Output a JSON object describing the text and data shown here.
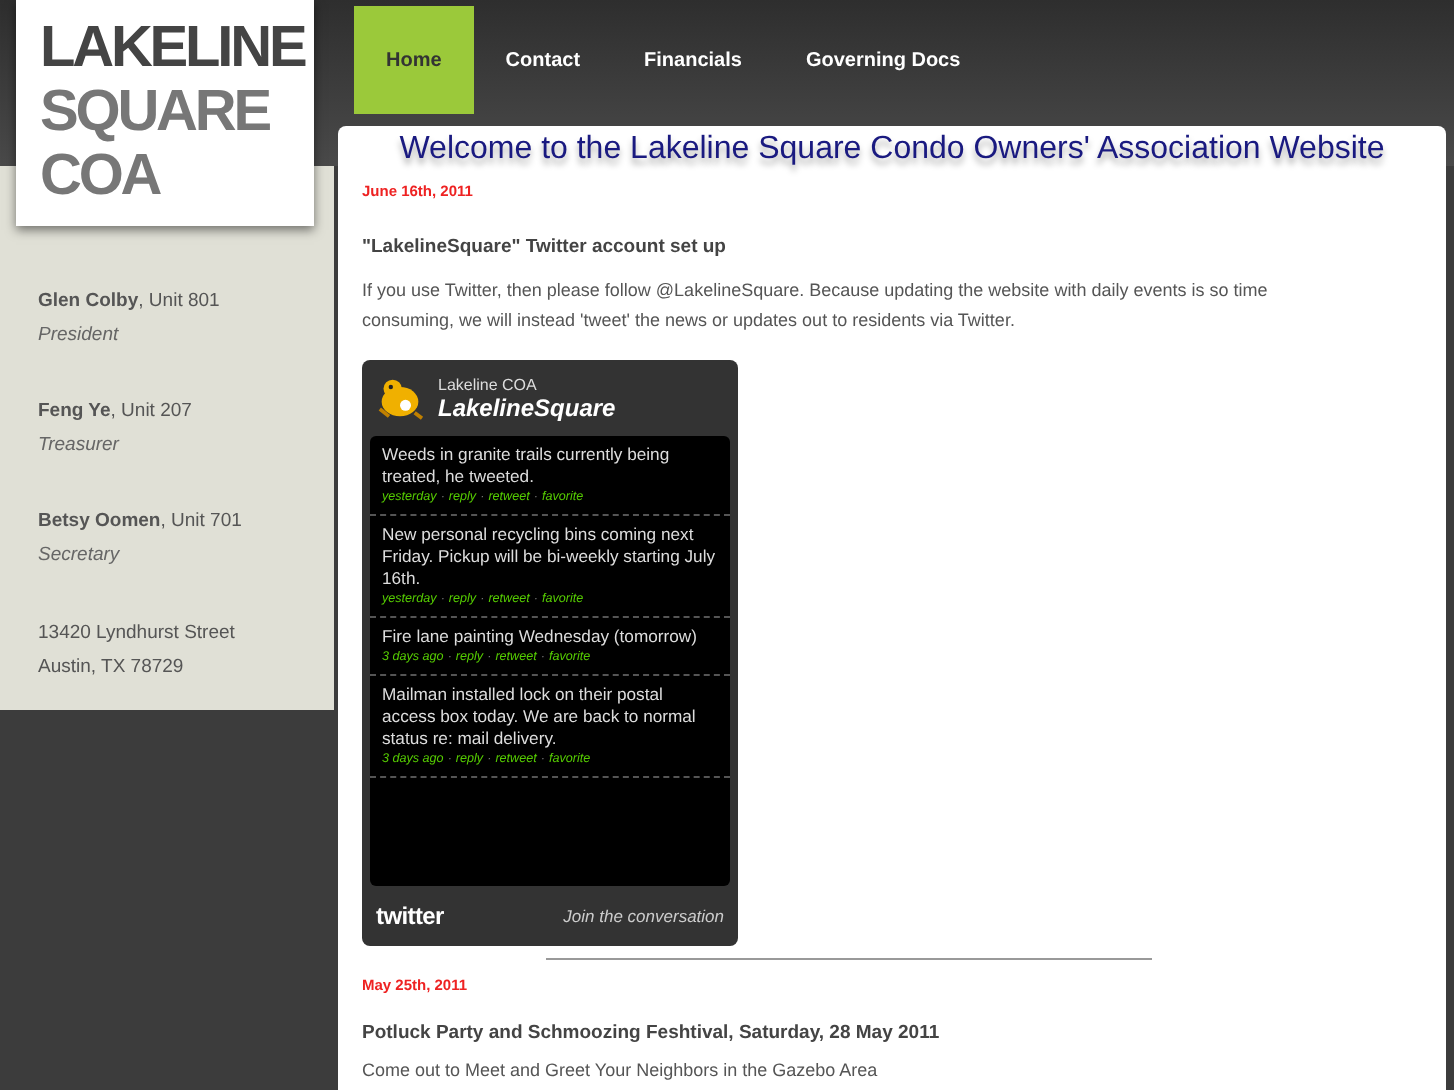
{
  "logo": {
    "lines": [
      "LAKELINE",
      "SQUARE",
      "COA"
    ]
  },
  "nav": [
    {
      "label": "Home",
      "selected": true
    },
    {
      "label": "Contact",
      "selected": false
    },
    {
      "label": "Financials",
      "selected": false
    },
    {
      "label": "Governing Docs",
      "selected": false
    }
  ],
  "sidebar": {
    "officers": [
      {
        "name": "Glen Colby",
        "unit": ", Unit 801",
        "role": "President"
      },
      {
        "name": "Feng Ye",
        "unit": ", Unit 207",
        "role": "Treasurer"
      },
      {
        "name": "Betsy Oomen",
        "unit": ", Unit 701",
        "role": "Secretary"
      }
    ],
    "address": [
      "13420 Lyndhurst Street",
      "Austin, TX 78729"
    ]
  },
  "page_title": "Welcome to the Lakeline Square Condo Owners' Association Website",
  "posts": [
    {
      "date": "June 16th, 2011",
      "title": "\"LakelineSquare\" Twitter account set up",
      "body": "If you use Twitter, then please follow @LakelineSquare. Because updating the website with daily events is so time consuming, we will instead 'tweet' the news or updates out to residents via Twitter.",
      "twitter_widget": {
        "account_name": "Lakeline COA",
        "handle": "LakelineSquare",
        "separator": "·",
        "tweets": [
          {
            "text": "Weeds in granite trails currently being treated, he tweeted.",
            "time": "yesterday",
            "actions": [
              "reply",
              "retweet",
              "favorite"
            ]
          },
          {
            "text": "New personal recycling bins coming next Friday. Pickup will be bi-weekly starting July 16th.",
            "time": "yesterday",
            "actions": [
              "reply",
              "retweet",
              "favorite"
            ]
          },
          {
            "text": "Fire lane painting Wednesday (tomorrow)",
            "time": "3 days ago",
            "actions": [
              "reply",
              "retweet",
              "favorite"
            ]
          },
          {
            "text": "Mailman installed lock on their postal access box today. We are back to normal status re: mail delivery.",
            "time": "3 days ago",
            "actions": [
              "reply",
              "retweet",
              "favorite"
            ]
          }
        ],
        "footer_logo": "twitter",
        "join_link": "Join the conversation"
      }
    },
    {
      "date": "May 25th, 2011",
      "title": "Potluck Party and Schmoozing Feshtival, Saturday, 28 May 2011",
      "body": "Come out to Meet and Greet Your Neighbors in the Gazebo Area"
    }
  ]
}
